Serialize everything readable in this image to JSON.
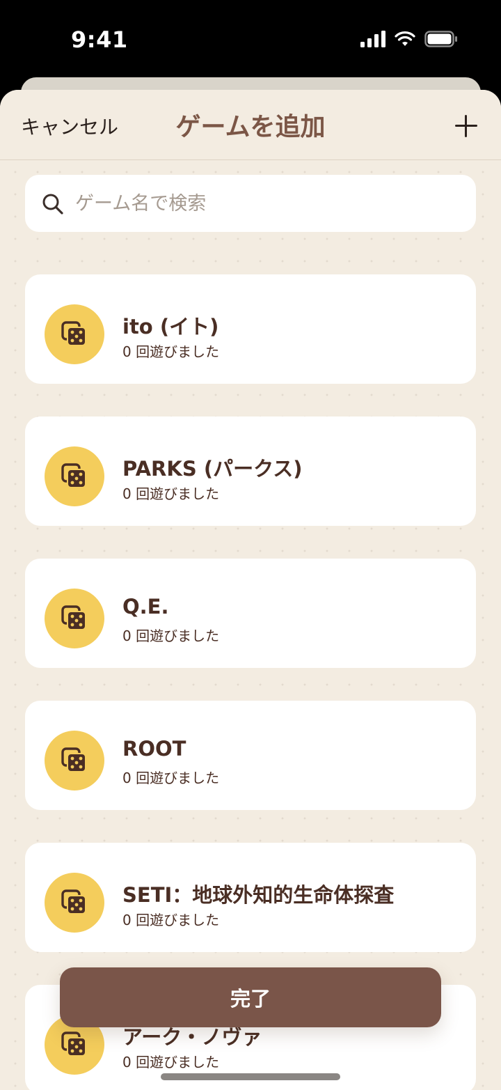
{
  "status_bar": {
    "time": "9:41",
    "icons": [
      "signal-icon",
      "wifi-icon",
      "battery-icon"
    ]
  },
  "nav": {
    "cancel_label": "キャンセル",
    "title": "ゲームを追加",
    "add_icon": "plus-icon"
  },
  "search": {
    "placeholder": "ゲーム名で検索",
    "value": ""
  },
  "games": [
    {
      "name": "ito (イト)",
      "plays": "0 回遊びました",
      "icon": "dice-icon"
    },
    {
      "name": "PARKS (パークス)",
      "plays": "0 回遊びました",
      "icon": "dice-icon"
    },
    {
      "name": "Q.E.",
      "plays": "0 回遊びました",
      "icon": "dice-icon"
    },
    {
      "name": "ROOT",
      "plays": "0 回遊びました",
      "icon": "dice-icon"
    },
    {
      "name": "SETI：地球外知的生命体探査",
      "plays": "0 回遊びました",
      "icon": "dice-icon"
    },
    {
      "name": "アーク・ノヴァ",
      "plays": "0 回遊びました",
      "icon": "dice-icon"
    }
  ],
  "footer": {
    "done_label": "完了"
  },
  "colors": {
    "background": "#f3ece1",
    "accent_brown": "#7a5549",
    "title_brown": "#7b5646",
    "icon_yellow": "#f4cd5c",
    "text_dark": "#4a2e24"
  }
}
